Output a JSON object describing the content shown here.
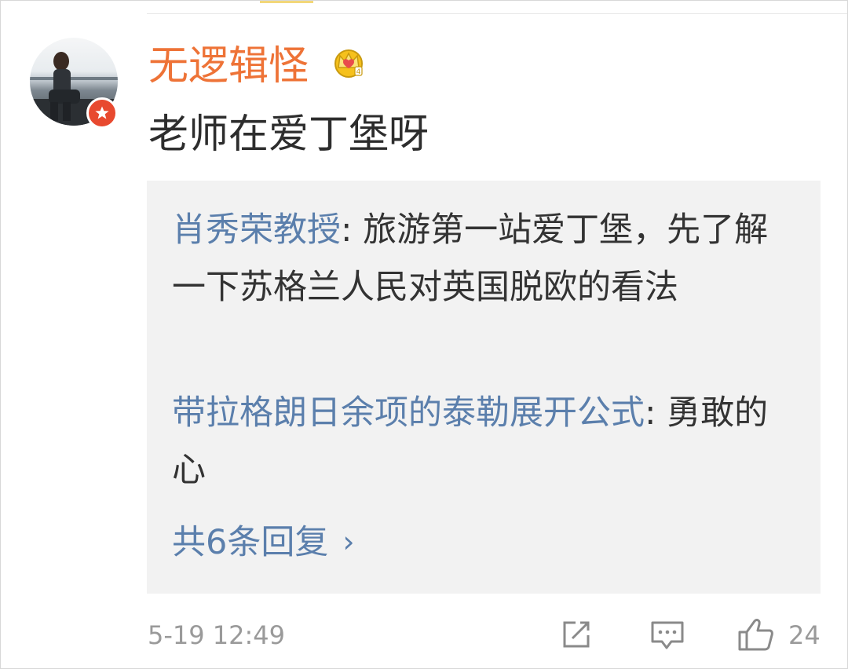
{
  "comment": {
    "username": "无逻辑怪",
    "text": "老师在爱丁堡呀",
    "timestamp": "5-19 12:49",
    "likes": "24"
  },
  "replies": [
    {
      "author": "肖秀荣教授",
      "separator": ": ",
      "text": "旅游第一站爱丁堡，先了解一下苏格兰人民对英国脱欧的看法"
    },
    {
      "author": "带拉格朗日余项的泰勒展开公式",
      "separator": ": ",
      "text": "勇敢的心"
    }
  ],
  "more_replies": {
    "label": "共6条回复",
    "chevron": "›"
  },
  "icons": {
    "avatar_badge": "verified-star-icon",
    "member": "crown-icon",
    "actions": [
      "share-icon",
      "comment-icon",
      "like-icon"
    ]
  },
  "colors": {
    "username": "#ee7337",
    "link": "#5b7fac",
    "badge": "#e8492f",
    "reply_bg": "#f2f2f2",
    "meta": "#9a9a9a"
  }
}
